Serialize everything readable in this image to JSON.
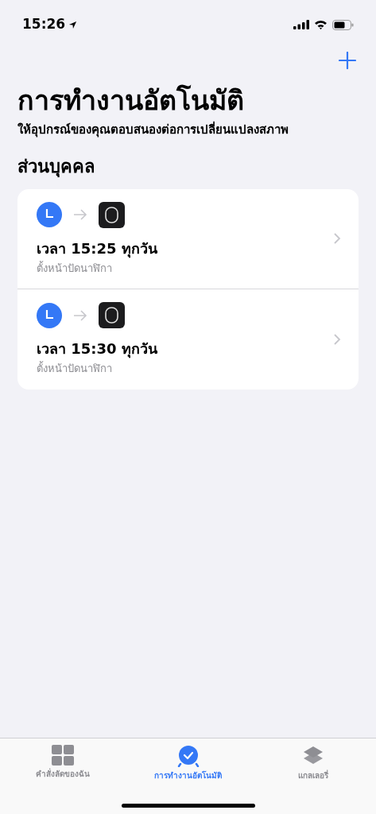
{
  "status_bar": {
    "time": "15:26"
  },
  "header": {
    "title": "การทำงานอัตโนมัติ",
    "subtitle": "ให้อุปกรณ์ของคุณตอบสนองต่อการเปลี่ยนแปลงสภาพ"
  },
  "section": {
    "title": "ส่วนบุคคล"
  },
  "automations": [
    {
      "title": "เวลา 15:25 ทุกวัน",
      "action": "ตั้งหน้าปัดนาฬิกา"
    },
    {
      "title": "เวลา 15:30 ทุกวัน",
      "action": "ตั้งหน้าปัดนาฬิกา"
    }
  ],
  "tabs": [
    {
      "kind": "grid",
      "label": "คำสั่งลัดของฉัน",
      "selected": false
    },
    {
      "kind": "automation",
      "label": "การทำงานอัตโนมัติ",
      "selected": true
    },
    {
      "kind": "layers",
      "label": "แกลเลอรี่",
      "selected": false
    }
  ]
}
